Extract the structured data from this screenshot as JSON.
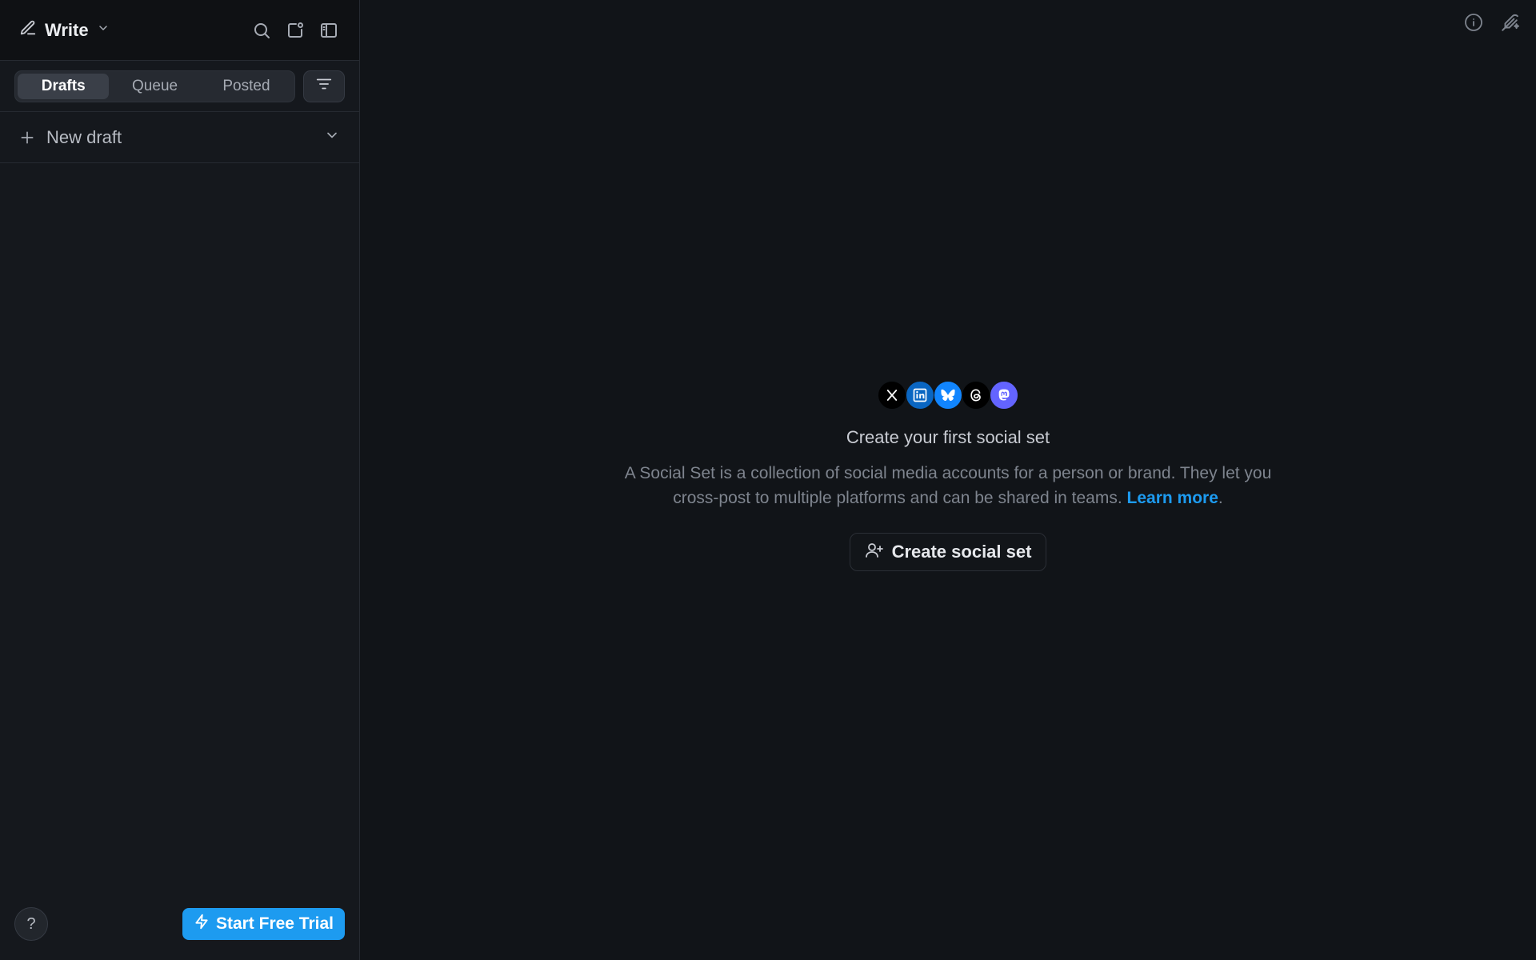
{
  "sidebar": {
    "header": {
      "title": "Write",
      "icons": [
        "pencil-icon",
        "chevron-down-icon",
        "search-icon",
        "new-window-icon",
        "sidebar-toggle-icon"
      ]
    },
    "tabs": [
      {
        "label": "Drafts",
        "active": true
      },
      {
        "label": "Queue",
        "active": false
      },
      {
        "label": "Posted",
        "active": false
      }
    ],
    "new_draft_label": "New draft",
    "footer": {
      "help_label": "?",
      "trial_label": "Start Free Trial"
    }
  },
  "main": {
    "empty_state": {
      "platforms": [
        "x",
        "linkedin",
        "bluesky",
        "threads",
        "mastodon"
      ],
      "title": "Create your first social set",
      "description": "A Social Set is a collection of social media accounts for a person or brand. They let you cross-post to multiple platforms and can be shared in teams.",
      "link_text": "Learn more",
      "trailing": ".",
      "button_label": "Create social set"
    }
  },
  "colors": {
    "accent": "#1d9bf0",
    "background": "#111418",
    "sidebar": "#15181d"
  }
}
